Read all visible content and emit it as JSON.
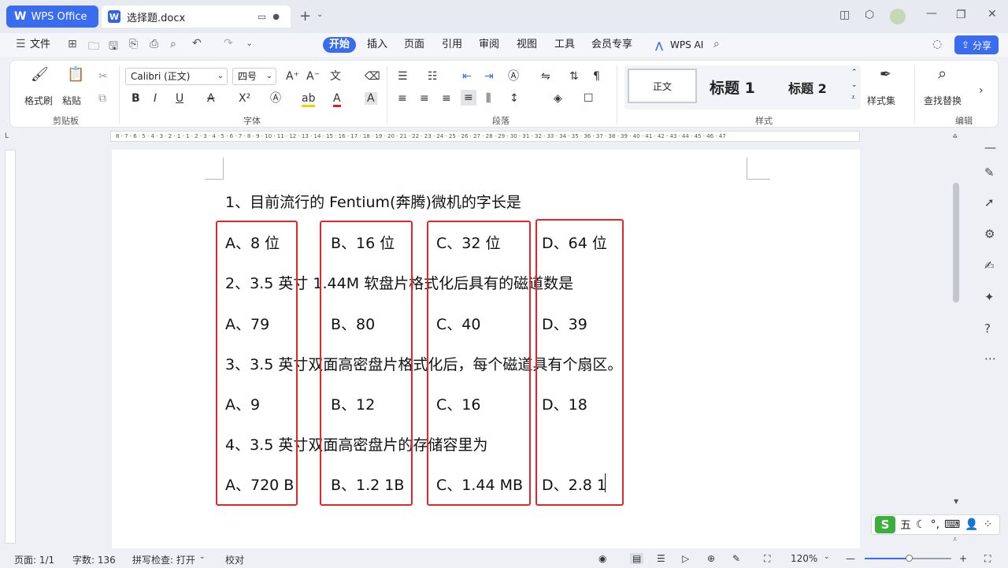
{
  "titlebar": {
    "app_tab": "WPS Office",
    "doc_tab": "选择题.docx",
    "new_tab_icon": "plus-icon"
  },
  "menubar": {
    "file": "文件",
    "tabs": [
      "开始",
      "插入",
      "页面",
      "引用",
      "审阅",
      "视图",
      "工具",
      "会员专享"
    ],
    "wps_ai": "WPS AI",
    "share": "分享"
  },
  "ribbon": {
    "format_painter": "格式刷",
    "paste": "粘贴",
    "clipboard_group": "剪贴板",
    "font_name": "Calibri (正文)",
    "font_size": "四号",
    "font_group": "字体",
    "paragraph_group": "段落",
    "style_normal": "正文",
    "style_h1": "标题 1",
    "style_h2": "标题 2",
    "style_set": "样式集",
    "styles_group": "样式",
    "find_replace": "查找替换",
    "edit_group": "编辑"
  },
  "ruler": {
    "ticks": "8 · 7 · 6 · 5 · 4 · 3 · 2 · 1 · 1 · 2 · 3 · 4 · 5 · 6 · 7 · 8 · 9 · 10 · 11 · 12 · 13 · 14 · 15 · 16 · 17 · 18 · 19 · 20 · 21 · 22 · 23 · 24 · 25 · 26 · 27 · 28 · 29 · 30 · 31 · 32 · 33 · 34 · 35 · 36 · 37 · 38 · 39 · 40 · 41 · 42 · 43 · 44 · 45 · 46 · 47"
  },
  "document": {
    "q1": "1、目前流行的 Fentium(奔腾)微机的字长是",
    "q1_options": [
      "A、8 位",
      "B、16 位",
      "C、32 位",
      "D、64 位"
    ],
    "q2": "2、3.5 英寸 1.44M 软盘片格式化后具有的磁道数是",
    "q2_options": [
      "A、79",
      "B、80",
      "C、40",
      "D、39"
    ],
    "q3": "3、3.5 英寸双面高密盘片格式化后，每个磁道具有个扇区。",
    "q3_options": [
      "A、9",
      "B、12",
      "C、16",
      "D、18"
    ],
    "q4": "4、3.5 英寸双面高密盘片的存储容里为",
    "q4_options": [
      "A、720 B",
      "B、1.2 1B",
      "C、1.44 MB",
      "D、2.8 1"
    ]
  },
  "ime": {
    "logo": "S",
    "mode": "五"
  },
  "status": {
    "page": "页面: 1/1",
    "words": "字数: 136",
    "spell": "拼写检查: 打开",
    "proof": "校对",
    "zoom": "120%"
  },
  "colors": {
    "accent": "#3a6cf0",
    "highlight_box": "#e3262b"
  }
}
